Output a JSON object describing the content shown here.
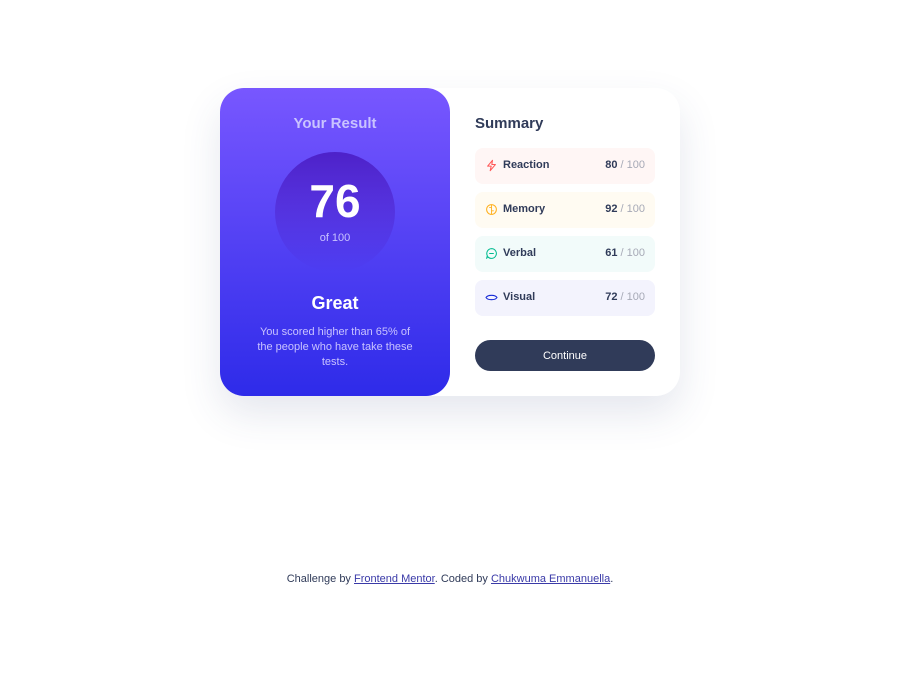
{
  "result": {
    "title": "Your Result",
    "score": "76",
    "score_of": "of 100",
    "rating": "Great",
    "description": "You scored higher than 65% of the people who have take these tests."
  },
  "summary": {
    "title": "Summary",
    "items": [
      {
        "label": "Reaction",
        "score": "80",
        "max": "/ 100",
        "color": "#ff5757",
        "bg": "#fff6f5",
        "icon": "lightning-icon"
      },
      {
        "label": "Memory",
        "score": "92",
        "max": "/ 100",
        "color": "#ffb01f",
        "bg": "#fffbf2",
        "icon": "brain-icon"
      },
      {
        "label": "Verbal",
        "score": "61",
        "max": "/ 100",
        "color": "#00bb8f",
        "bg": "#f2fbfa",
        "icon": "chat-bubble-icon"
      },
      {
        "label": "Visual",
        "score": "72",
        "max": "/ 100",
        "color": "#1125d6",
        "bg": "#f3f3fd",
        "icon": "eye-icon"
      }
    ],
    "continue_label": "Continue"
  },
  "attribution": {
    "prefix": "Challenge by",
    "link1": "Frontend Mentor",
    "middle": ". Coded by",
    "link2": "Chukwuma Emmanuella",
    "suffix": "."
  }
}
